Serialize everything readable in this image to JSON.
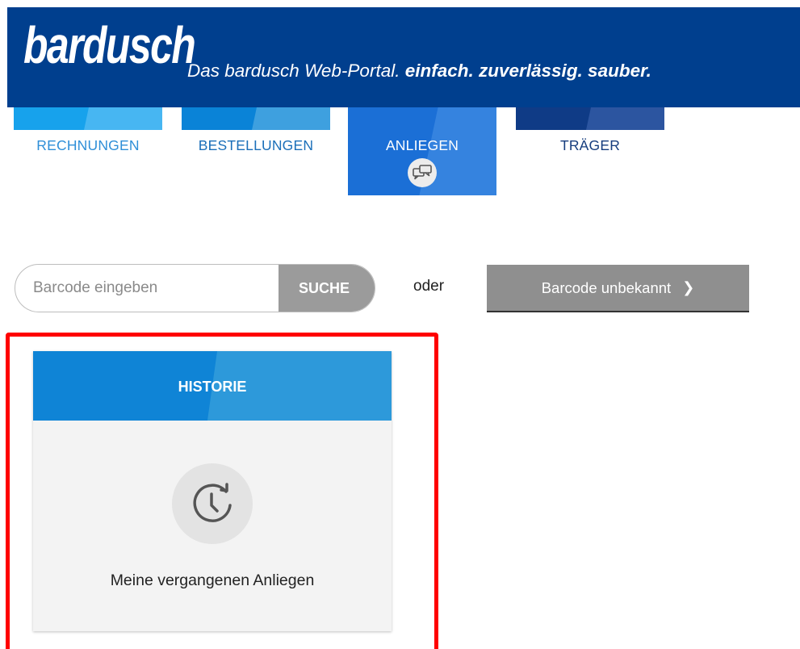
{
  "header": {
    "logo_text": "bardusch",
    "tagline_prefix": "Das bardusch Web-Portal. ",
    "tagline_emphasis": "einfach. zuverlässig. sauber.",
    "background_color": "#003f8e"
  },
  "tabs": [
    {
      "label": "RECHNUNGEN",
      "active": false,
      "color": "#17a2ec"
    },
    {
      "label": "BESTELLUNGEN",
      "active": false,
      "color": "#0a83d7"
    },
    {
      "label": "ANLIEGEN",
      "active": true,
      "color": "#1b6fd6",
      "icon": "chat-bubbles-icon"
    },
    {
      "label": "TRÄGER",
      "active": false,
      "color": "#0f3b86"
    }
  ],
  "search": {
    "placeholder": "Barcode eingeben",
    "value": "",
    "button_label": "SUCHE"
  },
  "separator_text": "oder",
  "unknown_barcode_button": {
    "label": "Barcode unbekannt",
    "icon": "chevron-right-icon"
  },
  "history_card": {
    "title": "HISTORIE",
    "icon": "history-clock-icon",
    "description": "Meine vergangenen Anliegen",
    "highlight_color": "#ff0000"
  }
}
